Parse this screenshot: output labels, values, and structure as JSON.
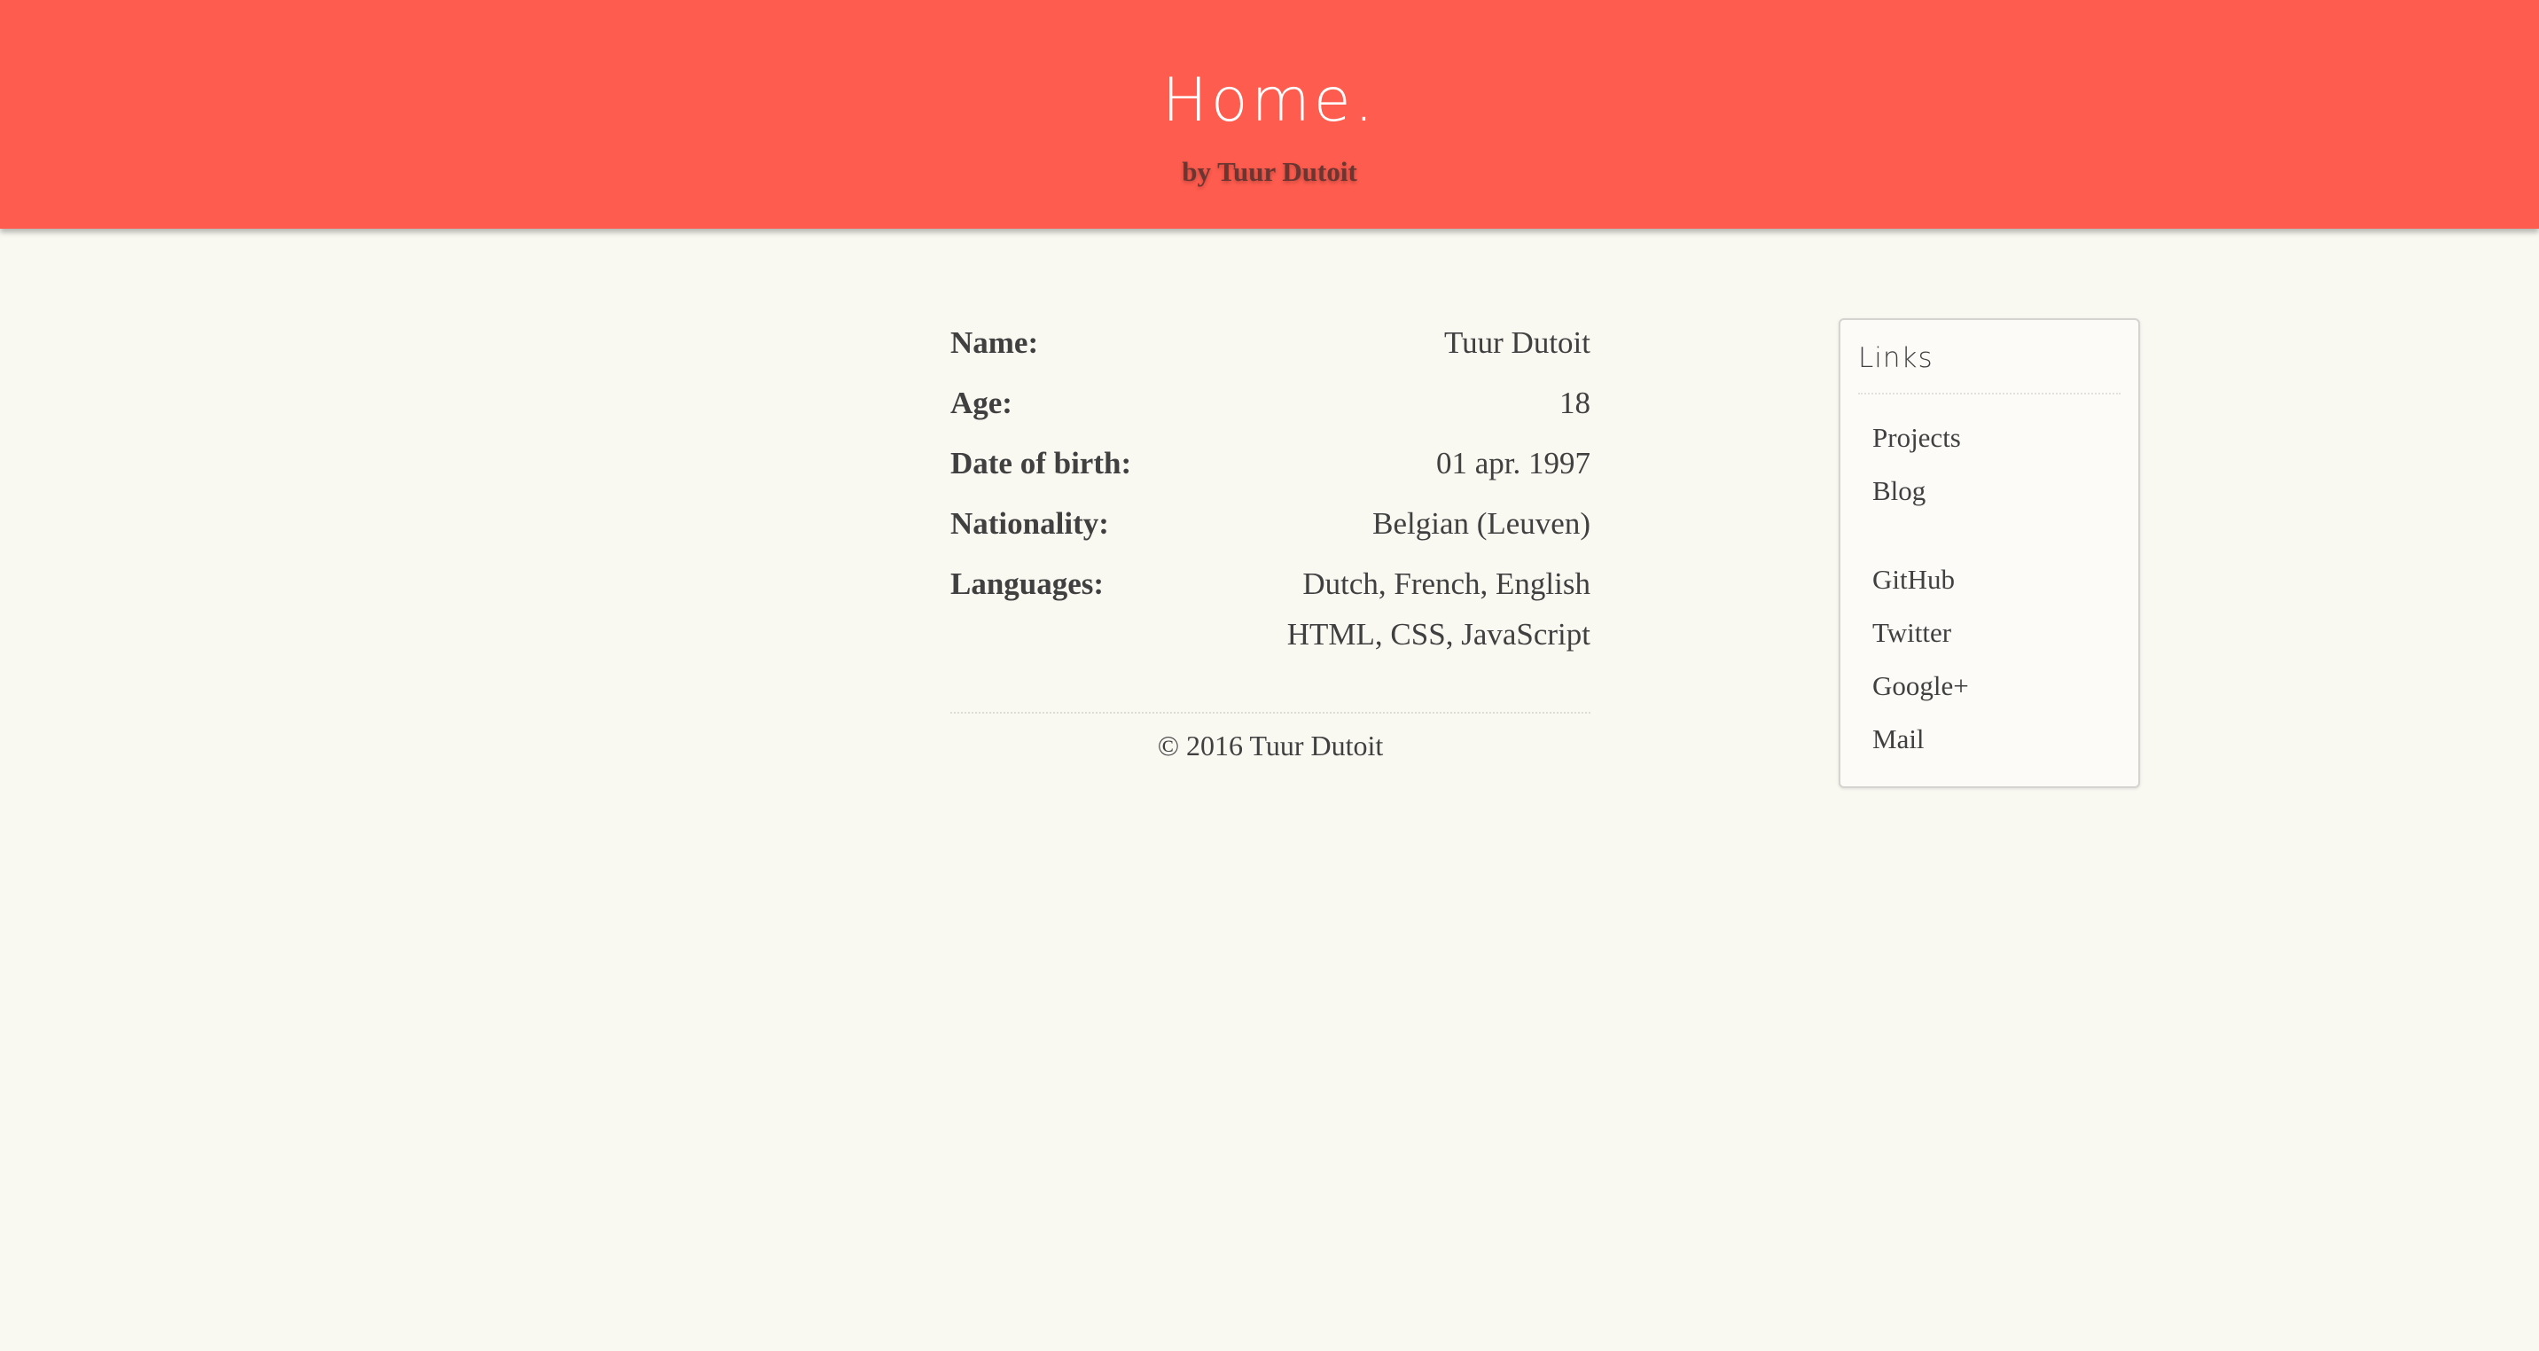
{
  "header": {
    "title": "Home.",
    "subtitle": "by Tuur Dutoit",
    "background_color": "#fe5c4e"
  },
  "info": {
    "rows": [
      {
        "label": "Name:",
        "values": [
          "Tuur Dutoit"
        ]
      },
      {
        "label": "Age:",
        "values": [
          "18"
        ]
      },
      {
        "label": "Date of birth:",
        "values": [
          "01 apr. 1997"
        ]
      },
      {
        "label": "Nationality:",
        "values": [
          "Belgian (Leuven)"
        ]
      },
      {
        "label": "Languages:",
        "values": [
          "Dutch, French, English",
          "HTML, CSS, JavaScript"
        ]
      }
    ]
  },
  "footer": {
    "text": "© 2016 Tuur Dutoit"
  },
  "sidebar": {
    "title": "Links",
    "items": [
      {
        "label": "Projects",
        "name": "link-projects"
      },
      {
        "label": "Blog",
        "name": "link-blog"
      },
      {
        "label": "GitHub",
        "name": "link-github"
      },
      {
        "label": "Twitter",
        "name": "link-twitter"
      },
      {
        "label": "Google+",
        "name": "link-google-plus"
      },
      {
        "label": "Mail",
        "name": "link-mail"
      }
    ]
  },
  "colors": {
    "page_background": "#f9f8f1",
    "text": "#404040",
    "subtitle": "#6b3531"
  }
}
